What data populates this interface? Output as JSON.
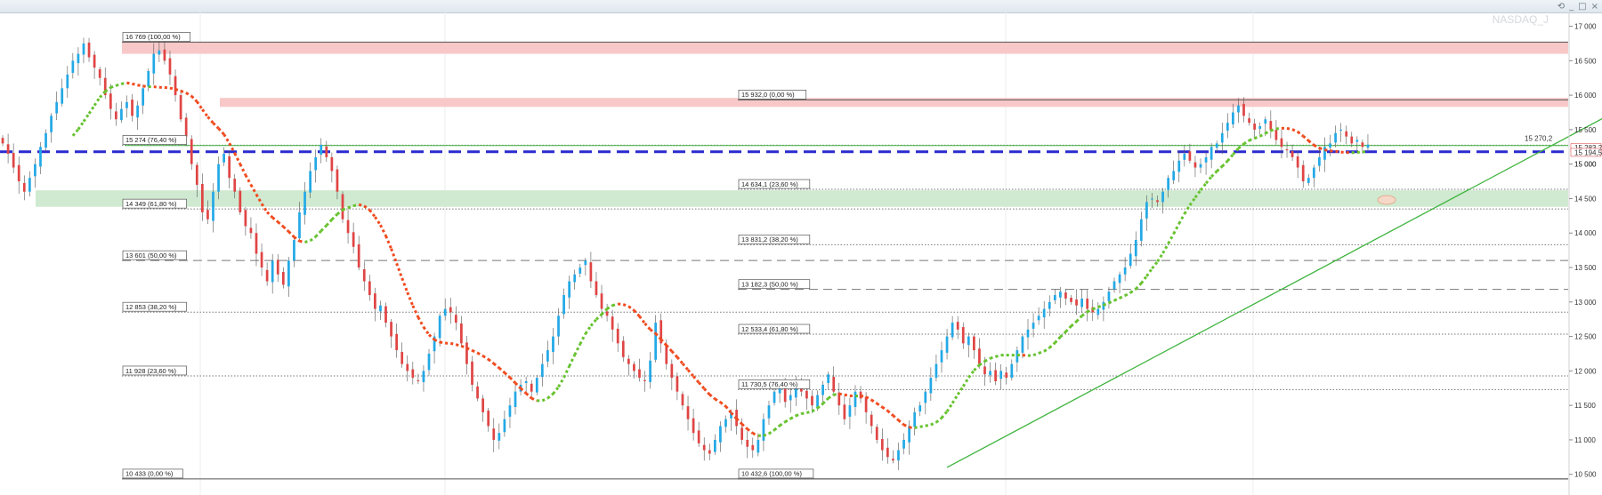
{
  "window": {
    "controls": [
      "⟲",
      "_",
      "□",
      "×"
    ]
  },
  "chart_data": {
    "type": "candlestick",
    "symbol": "NASDAQ_J",
    "ylim": [
      10200,
      17200
    ],
    "yticks": [
      "17 000",
      "16 500",
      "16 000",
      "15 500",
      "15 000",
      "14 500",
      "14 000",
      "13 500",
      "13 000",
      "12 500",
      "12 000",
      "11 500",
      "11 000",
      "10 500"
    ],
    "ytick_values": [
      17000,
      16500,
      16000,
      15500,
      15000,
      14500,
      14000,
      13500,
      13000,
      12500,
      12000,
      11500,
      11000,
      10500
    ],
    "current_price_labels": [
      {
        "text": "15 270,2",
        "value": 15270,
        "color": "#3fb43f"
      },
      {
        "text": "15 283,2",
        "value": 15240,
        "color": "#e05a5a"
      },
      {
        "text": "15 194,5",
        "value": 15170,
        "color": "#e05a5a"
      },
      {
        "text": "15 000",
        "value": 15000,
        "color": "#000000"
      }
    ],
    "fib_left": [
      {
        "label": "16 769 (100,00 %)",
        "value": 16769,
        "style": "solid"
      },
      {
        "label": "15 274 (76,40 %)",
        "value": 15274,
        "style": "dot"
      },
      {
        "label": "14 349 (61,80 %)",
        "value": 14349,
        "style": "dot"
      },
      {
        "label": "13 601 (50,00 %)",
        "value": 13601,
        "style": "dash"
      },
      {
        "label": "12 853 (38,20 %)",
        "value": 12853,
        "style": "dot"
      },
      {
        "label": "11 928 (23,60 %)",
        "value": 11928,
        "style": "dot"
      },
      {
        "label": "10 433 (0,00 %)",
        "value": 10433,
        "style": "solid"
      }
    ],
    "fib_right": [
      {
        "label": "15 932,0 (0,00 %)",
        "value": 15932,
        "style": "solid"
      },
      {
        "label": "14 634,1 (23,60 %)",
        "value": 14634,
        "style": "dot"
      },
      {
        "label": "13 831,2 (38,20 %)",
        "value": 13831,
        "style": "dot"
      },
      {
        "label": "13 182,3 (50,00 %)",
        "value": 13182,
        "style": "dash"
      },
      {
        "label": "12 533,4 (61,80 %)",
        "value": 12533,
        "style": "dot"
      },
      {
        "label": "11 730,5 (76,40 %)",
        "value": 11730,
        "style": "dot"
      },
      {
        "label": "10 432,6 (100,00 %)",
        "value": 10433,
        "style": "solid"
      }
    ],
    "zones": [
      {
        "from": 16600,
        "to": 16769,
        "color": "#f8c8c8"
      },
      {
        "from": 15830,
        "to": 15960,
        "color": "#f8c8c8"
      },
      {
        "from": 14380,
        "to": 14620,
        "color": "#cfead0"
      }
    ],
    "support_line": {
      "value": 15180,
      "color": "#2a2ad0"
    },
    "ma_green_line": {
      "value": 15270,
      "color": "#3fb43f"
    },
    "trendline": {
      "start": {
        "bar": 175,
        "value": 10600
      },
      "end": {
        "bar": 307,
        "value": 16100
      },
      "color": "#3fb43f"
    },
    "closes": [
      15300,
      15150,
      14950,
      14750,
      14600,
      14800,
      15000,
      15250,
      15450,
      15700,
      15900,
      16100,
      16300,
      16500,
      16600,
      16750,
      16550,
      16400,
      16250,
      16000,
      15800,
      15650,
      15800,
      15900,
      15700,
      15850,
      16100,
      16350,
      16600,
      16650,
      16500,
      16300,
      16000,
      15650,
      15400,
      15000,
      14700,
      14300,
      14200,
      14600,
      15000,
      15150,
      14800,
      14600,
      14300,
      14100,
      14000,
      13700,
      13500,
      13300,
      13600,
      13400,
      13250,
      13600,
      13900,
      14300,
      14600,
      14900,
      15100,
      15280,
      15100,
      14900,
      14600,
      14200,
      14000,
      13800,
      13500,
      13300,
      13100,
      12900,
      12950,
      12700,
      12500,
      12300,
      12100,
      12000,
      11900,
      11850,
      12000,
      12250,
      12500,
      12800,
      12900,
      12850,
      12700,
      12400,
      12100,
      11800,
      11600,
      11400,
      11200,
      11000,
      11100,
      11300,
      11500,
      11700,
      11800,
      11850,
      11700,
      11900,
      12100,
      12300,
      12500,
      12800,
      13100,
      13300,
      13400,
      13500,
      13600,
      13300,
      13100,
      12900,
      12800,
      12600,
      12400,
      12200,
      12100,
      12000,
      11900,
      11850,
      12150,
      12700,
      12400,
      12100,
      11900,
      11700,
      11500,
      11300,
      11100,
      10950,
      10850,
      10800,
      11000,
      11200,
      11300,
      11400,
      11200,
      11000,
      10900,
      10850,
      11000,
      11300,
      11500,
      11700,
      11750,
      11550,
      11650,
      11800,
      11700,
      11600,
      11500,
      11650,
      11800,
      11950,
      11700,
      11500,
      11300,
      11500,
      11700,
      11600,
      11400,
      11200,
      11000,
      10850,
      10750,
      10700,
      10850,
      11000,
      11200,
      11400,
      11500,
      11700,
      11900,
      12100,
      12300,
      12500,
      12700,
      12600,
      12400,
      12500,
      12300,
      12100,
      11950,
      12000,
      11850,
      12000,
      11900,
      12100,
      12300,
      12500,
      12600,
      12700,
      12800,
      12900,
      13000,
      13100,
      13150,
      13050,
      13000,
      12950,
      13050,
      12900,
      12850,
      12900,
      13000,
      13150,
      13300,
      13400,
      13500,
      13700,
      13900,
      14200,
      14450,
      14500,
      14450,
      14600,
      14800,
      14900,
      15050,
      15150,
      15050,
      14950,
      15000,
      15100,
      15250,
      15300,
      15450,
      15600,
      15750,
      15850,
      15700,
      15600,
      15500,
      15550,
      15650,
      15500,
      15350,
      15250,
      15200,
      15100,
      14950,
      14750,
      14800,
      14950,
      15100,
      15250,
      15300,
      15450,
      15500,
      15400,
      15300,
      15350,
      15250,
      15283
    ]
  }
}
